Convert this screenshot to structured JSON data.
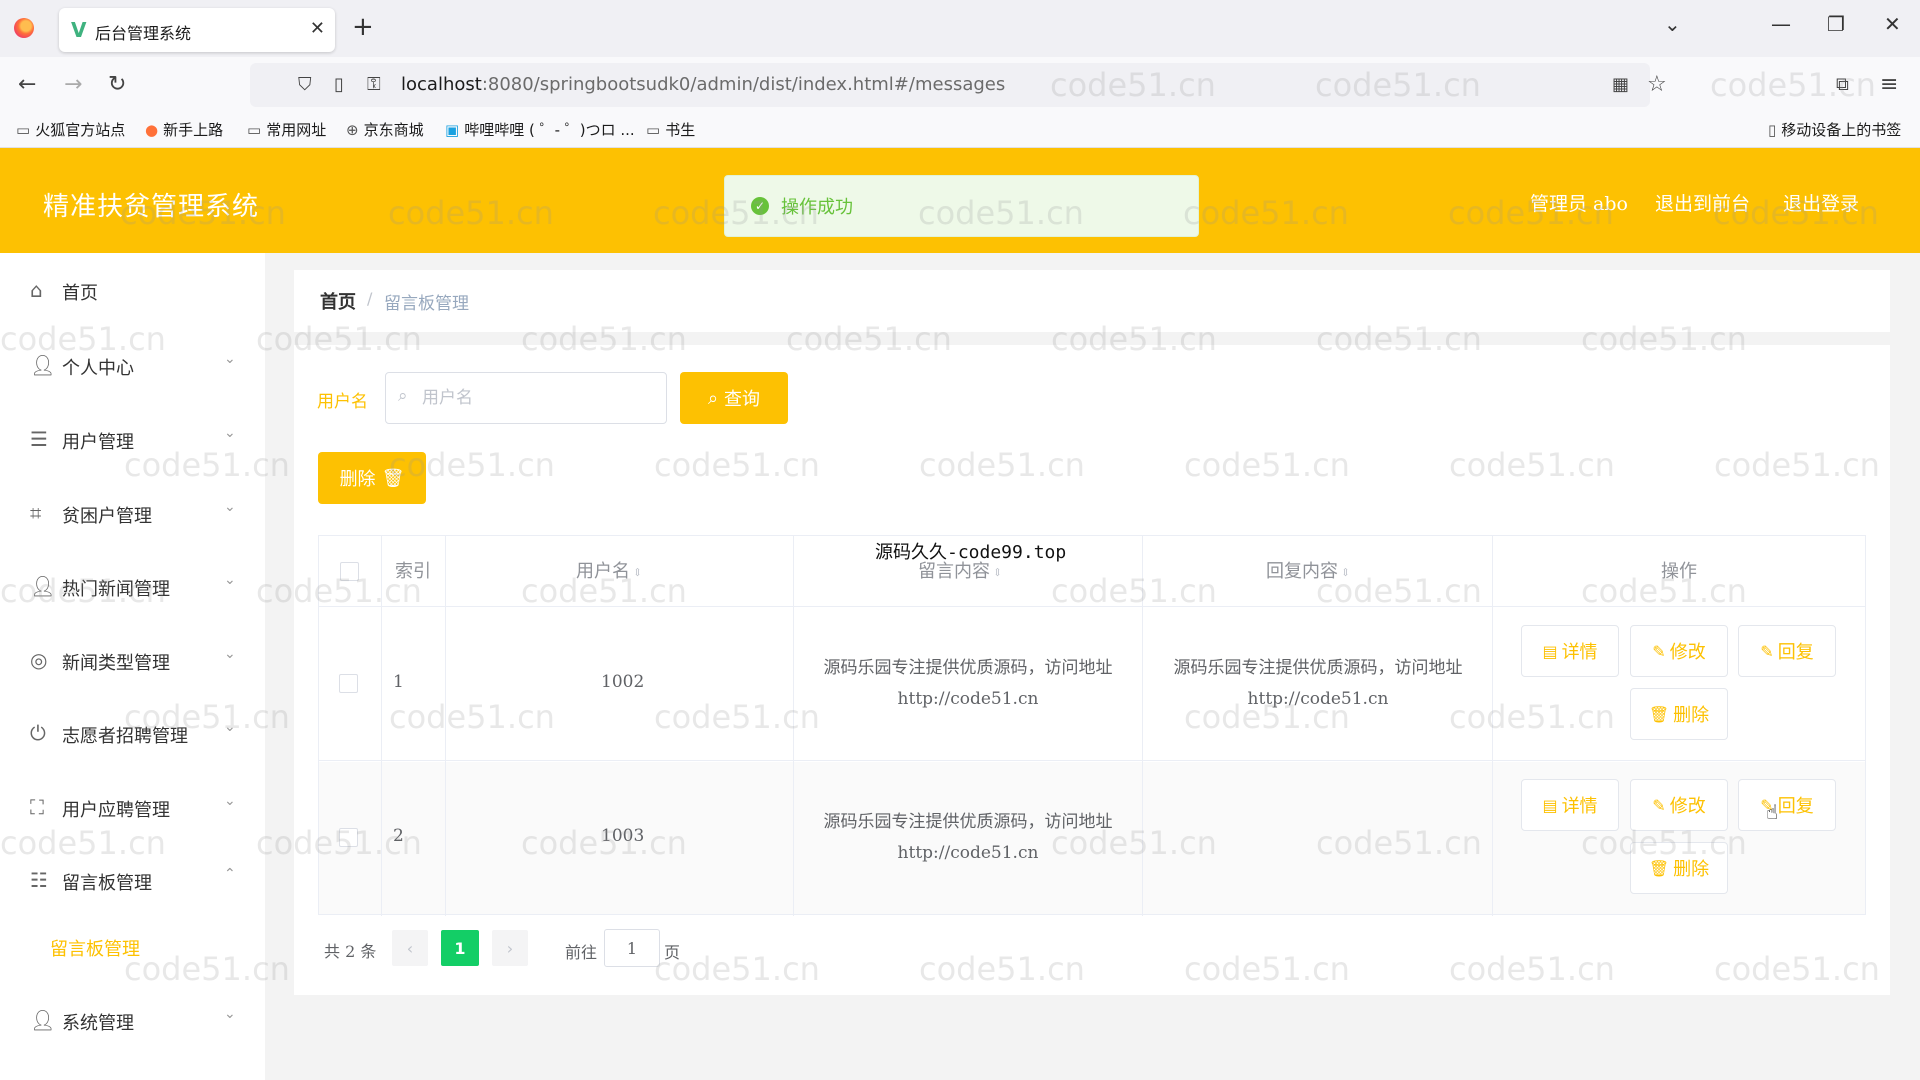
{
  "browser": {
    "tab_title": "后台管理系统",
    "url_host": "localhost",
    "url_path": ":8080/springbootsudk0/admin/dist/index.html#/messages",
    "bookmarks": [
      "火狐官方站点",
      "新手上路",
      "常用网址",
      "京东商城",
      "哔哩哔哩 ( ゜- ゜)つロ ...",
      "书生"
    ],
    "mobile_bookmarks": "移动设备上的书签"
  },
  "header": {
    "brand": "精准扶贫管理系统",
    "admin": "管理员 abo",
    "to_front": "退出到前台",
    "logout": "退出登录"
  },
  "toast": {
    "message": "操作成功"
  },
  "sidebar": {
    "items": [
      {
        "label": "首页",
        "icon": "home-icon"
      },
      {
        "label": "个人中心",
        "icon": "user-icon"
      },
      {
        "label": "用户管理",
        "icon": "list-icon"
      },
      {
        "label": "贫困户管理",
        "icon": "crop-icon"
      },
      {
        "label": "热门新闻管理",
        "icon": "user-icon"
      },
      {
        "label": "新闻类型管理",
        "icon": "globe-icon"
      },
      {
        "label": "志愿者招聘管理",
        "icon": "power-icon"
      },
      {
        "label": "用户应聘管理",
        "icon": "fullscreen-icon"
      },
      {
        "label": "留言板管理",
        "icon": "sliders-icon"
      },
      {
        "label": "系统管理",
        "icon": "user-icon"
      }
    ],
    "active_sub": "留言板管理"
  },
  "breadcrumb": {
    "home": "首页",
    "separator": "/",
    "current": "留言板管理"
  },
  "search": {
    "label": "用户名",
    "placeholder": "用户名",
    "button": "查询"
  },
  "toolbar": {
    "delete": "删除"
  },
  "table": {
    "headers": {
      "index": "索引",
      "username": "用户名",
      "content": "留言内容",
      "reply": "回复内容",
      "actions": "操作"
    },
    "rows": [
      {
        "index": "1",
        "username": "1002",
        "content": "源码乐园专注提供优质源码，访问地址http://code51.cn",
        "reply": "源码乐园专注提供优质源码，访问地址http://code51.cn"
      },
      {
        "index": "2",
        "username": "1003",
        "content": "源码乐园专注提供优质源码，访问地址http://code51.cn",
        "reply": ""
      }
    ],
    "actions": {
      "detail": "详情",
      "edit": "修改",
      "reply": "回复",
      "delete": "删除"
    }
  },
  "overlay": "源码久久-code99.top",
  "pagination": {
    "total": "共 2 条",
    "current_page": "1",
    "goto": "前往",
    "page_input": "1",
    "unit": "页"
  },
  "watermark": "code51.cn",
  "colors": {
    "brand": "#fdc102",
    "success": "#67c23a",
    "page_active": "#13ce66"
  }
}
